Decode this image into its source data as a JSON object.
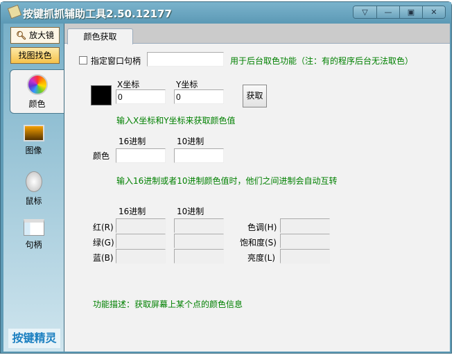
{
  "window": {
    "title": "按键抓抓辅助工具2.50.12177",
    "controls": [
      "▽",
      "—",
      "▣",
      "✕"
    ]
  },
  "sidebar": {
    "magnifier": "放大镜",
    "find_image_color": "找图找色",
    "items": [
      {
        "label": "颜色"
      },
      {
        "label": "图像"
      },
      {
        "label": "鼠标"
      },
      {
        "label": "句柄"
      }
    ],
    "logo": "按键精灵"
  },
  "tab": {
    "label": "颜色获取"
  },
  "handle": {
    "checkbox_label": "指定窗口句柄",
    "value": "",
    "note": "用于后台取色功能（注：有的程序后台无法取色）"
  },
  "coords": {
    "x_label": "X坐标",
    "y_label": "Y坐标",
    "x_value": "0",
    "y_value": "0",
    "get_button": "获取",
    "hint": "输入X坐标和Y坐标来获取颜色值",
    "swatch_color": "#000000"
  },
  "color_value": {
    "hex_label": "16进制",
    "dec_label": "10进制",
    "row_label": "颜色",
    "hex": "",
    "dec": "",
    "hint": "输入16进制或者10进制颜色值时，他们之间进制会自动互转"
  },
  "rgb": {
    "hex_label": "16进制",
    "dec_label": "10进制",
    "red": "红(R)",
    "green": "绿(G)",
    "blue": "蓝(B)",
    "hue": "色调(H)",
    "saturation": "饱和度(S)",
    "lightness": "亮度(L)"
  },
  "description": "功能描述：获取屏幕上某个点的颜色信息"
}
